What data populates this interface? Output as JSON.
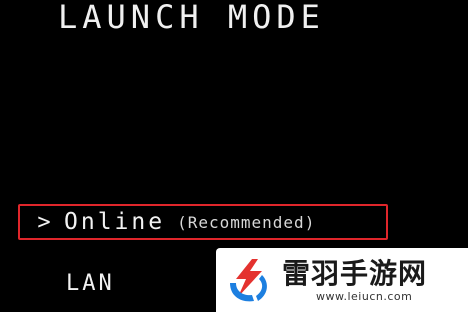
{
  "screen": {
    "title": "LAUNCH MODE"
  },
  "menu": {
    "options": [
      {
        "caret": ">",
        "label": "Online",
        "note": "(Recommended)",
        "selected": true
      },
      {
        "label": "LAN",
        "selected": false
      }
    ],
    "highlight_color": "#e0262b"
  },
  "watermark": {
    "name": "雷羽手游网",
    "url": "www.leiucn.com",
    "logo_icon": "leiyu-logo-icon",
    "logo_colors": [
      "#e4322f",
      "#1d7fe0"
    ]
  }
}
